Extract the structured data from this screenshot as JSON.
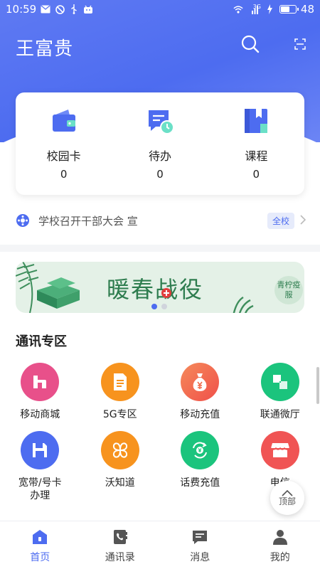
{
  "status_bar": {
    "time": "10:59",
    "battery": "48",
    "network": "3G",
    "icons": [
      "mail-icon",
      "no-disturb-icon",
      "usb-icon",
      "android-icon",
      "wifi-icon",
      "signal-icon",
      "charging-icon",
      "battery-icon"
    ]
  },
  "header": {
    "title": "王富贵",
    "search_icon": "search-icon",
    "scan_icon": "scan-icon"
  },
  "summary_card": [
    {
      "label": "校园卡",
      "value": "0",
      "icon": "wallet-icon",
      "color": "#4d6cf0"
    },
    {
      "label": "待办",
      "value": "0",
      "icon": "todo-clock-icon",
      "color": "#4d6cf0"
    },
    {
      "label": "课程",
      "value": "0",
      "icon": "book-icon",
      "color": "#4d6cf0"
    }
  ],
  "notice": {
    "text": "学校召开干部大会 宣",
    "badge": "全校"
  },
  "banner": {
    "text": "暖春战役",
    "badge": "青柠疫服",
    "active_dot": 0,
    "dot_count": 2
  },
  "section": {
    "title": "通讯专区"
  },
  "grid_items": [
    {
      "label": "移动商城",
      "icon": "mall-icon",
      "color": "#e8508a"
    },
    {
      "label": "5G专区",
      "icon": "document-icon",
      "color": "#f7931e"
    },
    {
      "label": "移动充值",
      "icon": "money-bag-icon",
      "color": "#f06a4a"
    },
    {
      "label": "联通微厅",
      "icon": "squares-icon",
      "color": "#1bc47d"
    },
    {
      "label": "宽带/号卡\n办理",
      "icon": "floppy-icon",
      "color": "#4d6cf0"
    },
    {
      "label": "沃知道",
      "icon": "clover-icon",
      "color": "#f7931e"
    },
    {
      "label": "话费充值",
      "icon": "yuan-cycle-icon",
      "color": "#1bc47d"
    },
    {
      "label": "电信",
      "icon": "shop-icon",
      "color": "#f05454"
    }
  ],
  "back_to_top": {
    "label": "顶部"
  },
  "tabs": [
    {
      "label": "首页",
      "icon": "home-icon",
      "active": true
    },
    {
      "label": "通讯录",
      "icon": "contacts-icon",
      "active": false
    },
    {
      "label": "消息",
      "icon": "message-icon",
      "active": false
    },
    {
      "label": "我的",
      "icon": "profile-icon",
      "active": false
    }
  ],
  "colors": {
    "accent": "#4d6cf0",
    "header_bg": "#5f7af3"
  }
}
